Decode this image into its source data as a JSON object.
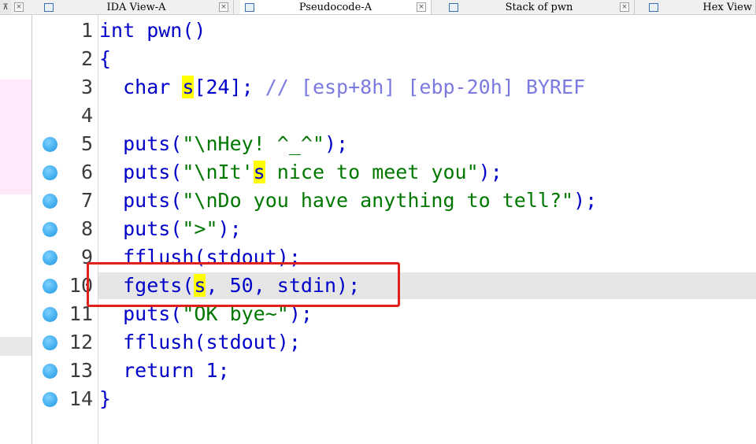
{
  "tabs": [
    {
      "label": "IDA View-A",
      "active": false,
      "icon": "disassembly-icon"
    },
    {
      "label": "Pseudocode-A",
      "active": true,
      "icon": "pseudocode-icon"
    },
    {
      "label": "Stack of pwn",
      "active": false,
      "icon": "stack-icon"
    },
    {
      "label": "Hex View",
      "active": false,
      "icon": "hex-icon"
    }
  ],
  "close_glyph": "×",
  "side_icon_glyph": "⊼",
  "code_lines": [
    {
      "num": "1",
      "bp": false,
      "parts": [
        {
          "t": "int pwn()",
          "c": "kw"
        }
      ]
    },
    {
      "num": "2",
      "bp": false,
      "parts": [
        {
          "t": "{",
          "c": "kw"
        }
      ]
    },
    {
      "num": "3",
      "bp": false,
      "parts": [
        {
          "t": "  char ",
          "c": "kw"
        },
        {
          "t": "s",
          "c": "hlvar"
        },
        {
          "t": "[24]; ",
          "c": "kw"
        },
        {
          "t": "// [esp+8h] [ebp-20h] BYREF",
          "c": "cmt"
        }
      ]
    },
    {
      "num": "4",
      "bp": false,
      "parts": [
        {
          "t": "",
          "c": "kw"
        }
      ]
    },
    {
      "num": "5",
      "bp": true,
      "parts": [
        {
          "t": "  puts(",
          "c": "kw"
        },
        {
          "t": "\"\\nHey! ^_^\"",
          "c": "str"
        },
        {
          "t": ");",
          "c": "kw"
        }
      ]
    },
    {
      "num": "6",
      "bp": true,
      "parts": [
        {
          "t": "  puts(",
          "c": "kw"
        },
        {
          "t": "\"\\nIt'",
          "c": "str"
        },
        {
          "t": "s",
          "c": "hlvar"
        },
        {
          "t": " nice to meet you\"",
          "c": "str"
        },
        {
          "t": ");",
          "c": "kw"
        }
      ]
    },
    {
      "num": "7",
      "bp": true,
      "parts": [
        {
          "t": "  puts(",
          "c": "kw"
        },
        {
          "t": "\"\\nDo you have anything to tell?\"",
          "c": "str"
        },
        {
          "t": ");",
          "c": "kw"
        }
      ]
    },
    {
      "num": "8",
      "bp": true,
      "parts": [
        {
          "t": "  puts(",
          "c": "kw"
        },
        {
          "t": "\">\"",
          "c": "str"
        },
        {
          "t": ");",
          "c": "kw"
        }
      ]
    },
    {
      "num": "9",
      "bp": true,
      "parts": [
        {
          "t": "  fflush(stdout);",
          "c": "kw"
        }
      ]
    },
    {
      "num": "10",
      "bp": true,
      "hl": true,
      "parts": [
        {
          "t": "  fgets(",
          "c": "kw"
        },
        {
          "t": "s",
          "c": "hlvar"
        },
        {
          "t": ", 50, stdin);",
          "c": "kw"
        }
      ]
    },
    {
      "num": "11",
      "bp": true,
      "parts": [
        {
          "t": "  puts(",
          "c": "kw"
        },
        {
          "t": "\"OK bye~\"",
          "c": "str"
        },
        {
          "t": ");",
          "c": "kw"
        }
      ]
    },
    {
      "num": "12",
      "bp": true,
      "parts": [
        {
          "t": "  fflush(stdout);",
          "c": "kw"
        }
      ]
    },
    {
      "num": "13",
      "bp": true,
      "parts": [
        {
          "t": "  return 1;",
          "c": "kw"
        }
      ]
    },
    {
      "num": "14",
      "bp": true,
      "parts": [
        {
          "t": "}",
          "c": "kw"
        }
      ]
    }
  ],
  "colors": {
    "highlight_box": "#e0201a",
    "var_highlight": "#ffff00",
    "string": "#007800",
    "keyword": "#0000c8",
    "comment": "#7a7ae0",
    "current_line": "#e6e6e6",
    "side_pink": "#fde9fb"
  }
}
